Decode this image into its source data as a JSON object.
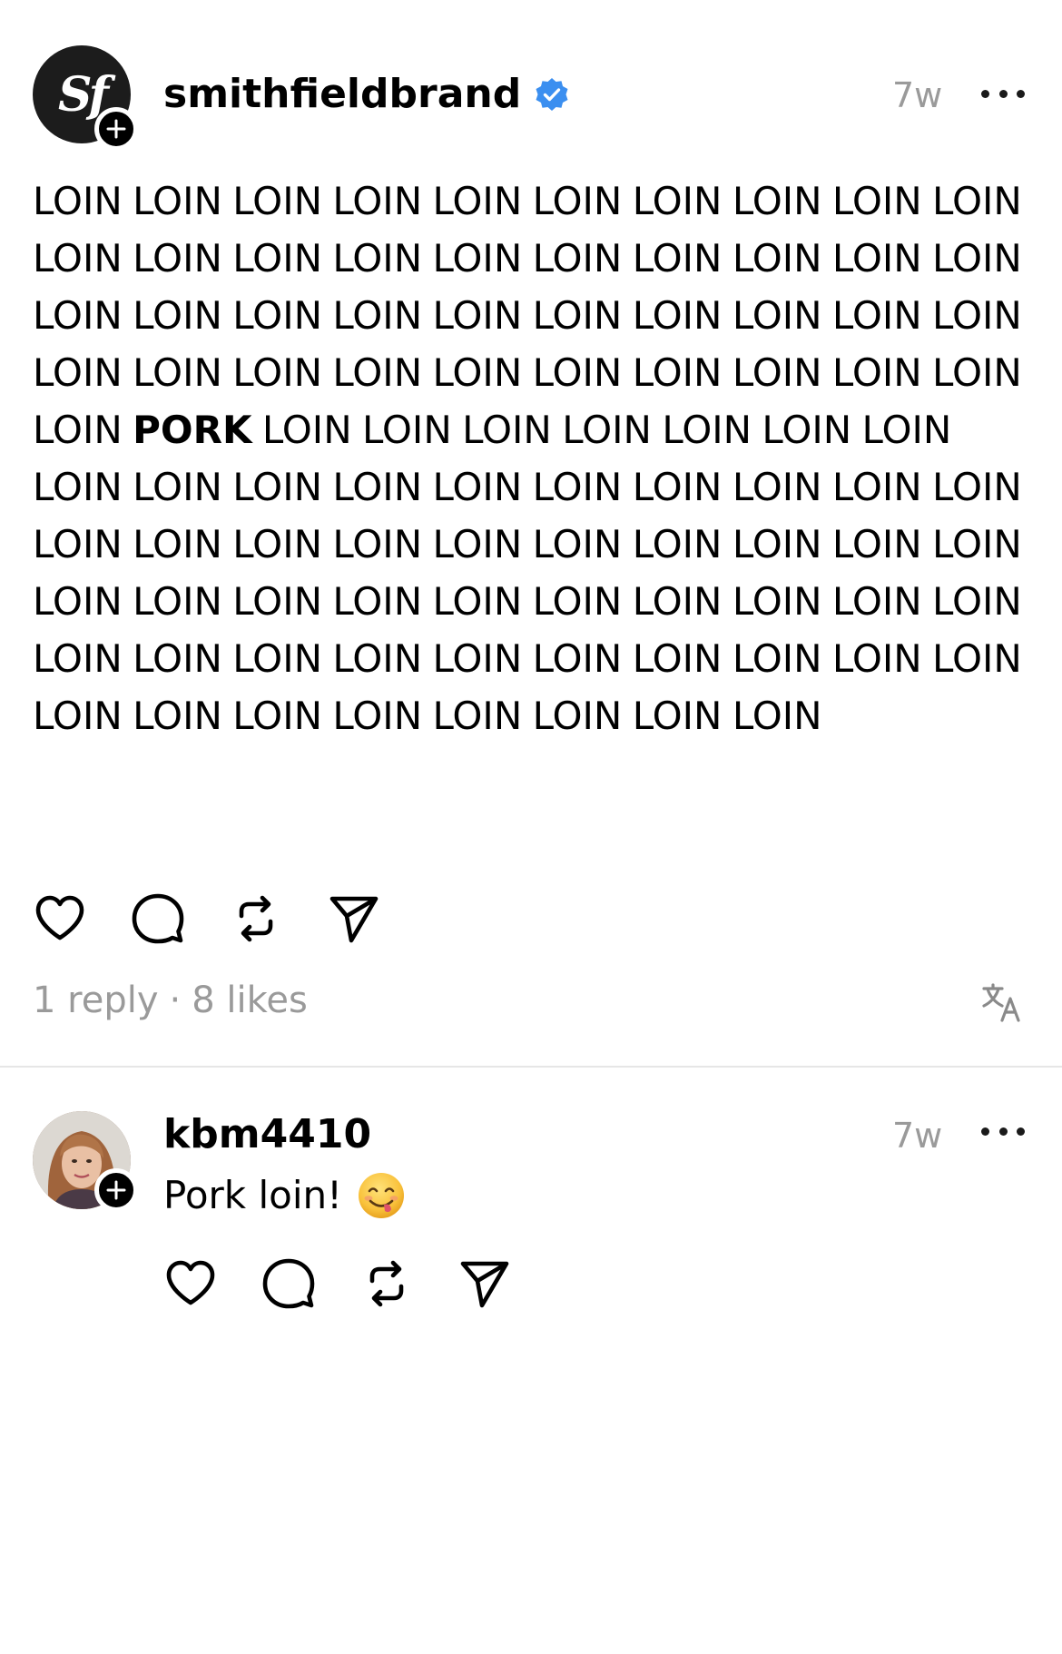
{
  "post": {
    "author": "smithfieldbrand",
    "avatar_monogram": "Sf",
    "verified": true,
    "time": "7w",
    "body_before": "LOIN LOIN LOIN LOIN LOIN LOIN LOIN LOIN LOIN LOIN LOIN LOIN LOIN LOIN LOIN LOIN LOIN LOIN LOIN LOIN LOIN LOIN LOIN LOIN LOIN LOIN LOIN LOIN LOIN LOIN LOIN LOIN LOIN LOIN LOIN LOIN LOIN LOIN LOIN LOIN LOIN ",
    "body_bold": "PORK",
    "body_after": " LOIN LOIN LOIN LOIN LOIN LOIN LOIN LOIN LOIN LOIN LOIN LOIN LOIN LOIN LOIN LOIN LOIN LOIN LOIN LOIN LOIN LOIN LOIN LOIN LOIN LOIN LOIN LOIN LOIN LOIN LOIN LOIN LOIN LOIN LOIN LOIN LOIN LOIN LOIN LOIN LOIN LOIN LOIN LOIN LOIN LOIN LOIN LOIN LOIN LOIN LOIN LOIN LOIN LOIN LOIN",
    "replies_label": "1 reply",
    "separator": "·",
    "likes_label": "8 likes",
    "icons": [
      "heart-icon",
      "comment-icon",
      "repost-icon",
      "share-icon",
      "translate-icon",
      "more-icon",
      "verified-badge-icon",
      "follow-plus-icon"
    ]
  },
  "reply": {
    "author": "kbm4410",
    "time": "7w",
    "text": "Pork loin!",
    "emoji": "face-savoring-food-emoji",
    "icons": [
      "heart-icon",
      "comment-icon",
      "repost-icon",
      "share-icon",
      "more-icon",
      "follow-plus-icon"
    ]
  },
  "colors": {
    "text": "#000000",
    "muted": "#9a9a9a",
    "verified": "#3b8ff0",
    "divider": "#e6e6e6",
    "avatar_dark": "#1c1c1c"
  }
}
